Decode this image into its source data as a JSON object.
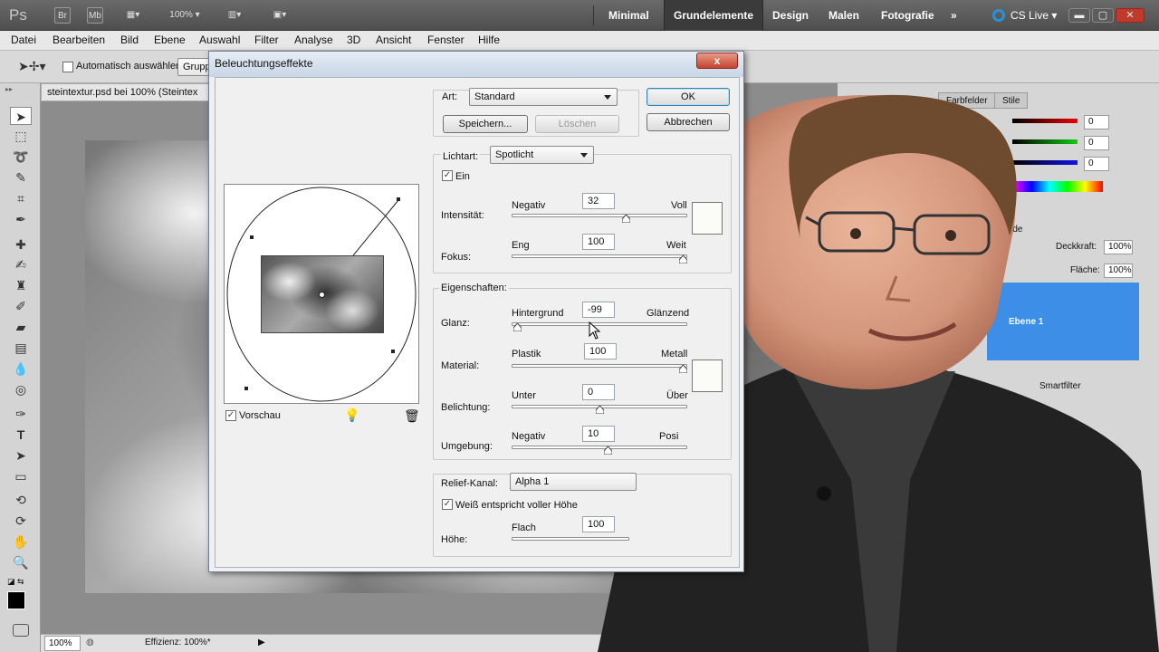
{
  "appbar": {
    "logo": "Ps",
    "bridge_label": "Br",
    "minibridge_label": "Mb",
    "zoom": "100%",
    "workspaces": [
      "Minimal",
      "Grundelemente",
      "Design",
      "Malen",
      "Fotografie"
    ],
    "active_workspace": "Grundelemente",
    "more": "»",
    "cs_live": "CS Live"
  },
  "menu": [
    "Datei",
    "Bearbeiten",
    "Bild",
    "Ebene",
    "Auswahl",
    "Filter",
    "Analyse",
    "3D",
    "Ansicht",
    "Fenster",
    "Hilfe"
  ],
  "options": {
    "auto_select_label": "Automatisch auswählen:",
    "auto_select_value": "Grupp"
  },
  "document": {
    "tab_title": "steintextur.psd bei 100% (Steintex",
    "status_zoom": "100%",
    "status_info": "Effizienz: 100%*"
  },
  "panels": {
    "tab_color": "Farbfelder",
    "tab_styles": "Stile",
    "color_values": [
      "0",
      "0",
      "0"
    ],
    "paths_tab": "fade",
    "opacity_label": "Deckkraft:",
    "opacity_value": "100%",
    "fill_label": "Fläche:",
    "fill_value": "100%",
    "layer_name": "Ebene 1",
    "smartfilter_label": "Smartfilter"
  },
  "dialog": {
    "title": "Beleuchtungseffekte",
    "close": "x",
    "ok": "OK",
    "cancel": "Abbrechen",
    "style_label": "Art:",
    "style_value": "Standard",
    "save": "Speichern...",
    "delete": "Löschen",
    "light_type_label": "Lichtart:",
    "light_type_value": "Spotlicht",
    "on_label": "Ein",
    "intensity_label": "Intensität:",
    "intensity_min": "Negativ",
    "intensity_max": "Voll",
    "intensity_value": "32",
    "focus_label": "Fokus:",
    "focus_min": "Eng",
    "focus_max": "Weit",
    "focus_value": "100",
    "properties_label": "Eigenschaften:",
    "gloss_label": "Glanz:",
    "gloss_min": "Hintergrund",
    "gloss_max": "Glänzend",
    "gloss_value": "-99",
    "material_label": "Material:",
    "material_min": "Plastik",
    "material_max": "Metall",
    "material_value": "100",
    "exposure_label": "Belichtung:",
    "exposure_min": "Unter",
    "exposure_max": "Über",
    "exposure_value": "0",
    "ambience_label": "Umgebung:",
    "ambience_min": "Negativ",
    "ambience_max": "Posi",
    "ambience_value": "10",
    "texture_label": "Relief-Kanal:",
    "texture_value": "Alpha 1",
    "white_high_label": "Weiß entspricht voller Höhe",
    "height_label": "Höhe:",
    "height_min": "Flach",
    "height_value": "100",
    "preview_label": "Vorschau",
    "slider_positions": {
      "intensity": 0.66,
      "focus": 1.0,
      "gloss": 0.01,
      "material": 1.0,
      "exposure": 0.5,
      "ambience": 0.55
    }
  }
}
